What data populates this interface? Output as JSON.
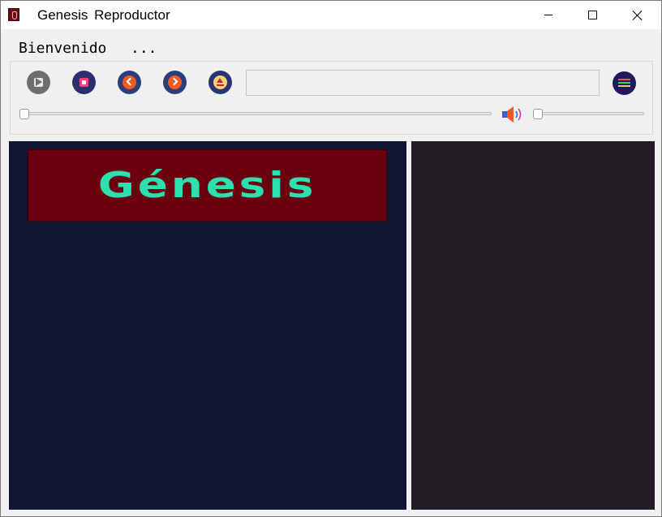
{
  "window": {
    "title": "Genesis  Reproductor",
    "app_icon": "app-logo-icon"
  },
  "menu": {
    "welcome": "Bienvenido",
    "more": "..."
  },
  "controls": {
    "play_icon": "play-icon",
    "stop_icon": "stop-icon",
    "previous_icon": "previous-icon",
    "next_icon": "next-icon",
    "eject_icon": "eject-icon",
    "playlist_icon": "playlist-icon",
    "track_value": "",
    "seek_position": 0,
    "volume_level": 0,
    "speaker_icon": "speaker-icon"
  },
  "banner": {
    "text": "Génesis",
    "text_color": "#2ee0b0",
    "background": "#6a0010"
  },
  "colors": {
    "left_panel": "#111631",
    "right_panel": "#221d25"
  }
}
